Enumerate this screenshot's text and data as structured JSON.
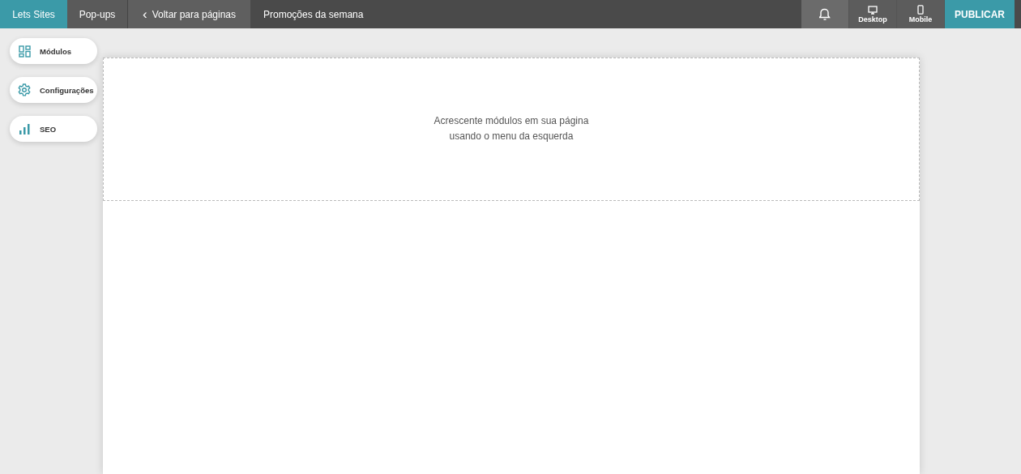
{
  "topbar": {
    "brand": "Lets Sites",
    "tabs": [
      "Pop-ups"
    ],
    "back": {
      "label": "Voltar para páginas",
      "icon": "‹"
    },
    "page_title": "Promoções da semana",
    "views": [
      {
        "kind": "desktop",
        "label": "Desktop"
      },
      {
        "kind": "mobile",
        "label": "Mobile"
      }
    ],
    "publish": "PUBLICAR"
  },
  "sidebar": {
    "items": [
      {
        "kind": "modules",
        "label": "Módulos"
      },
      {
        "kind": "settings",
        "label": "Configurações"
      },
      {
        "kind": "seo",
        "label": "SEO"
      }
    ]
  },
  "canvas": {
    "hint_lines": [
      "Acrescente módulos em sua página",
      "usando o menu da esquerda"
    ]
  }
}
